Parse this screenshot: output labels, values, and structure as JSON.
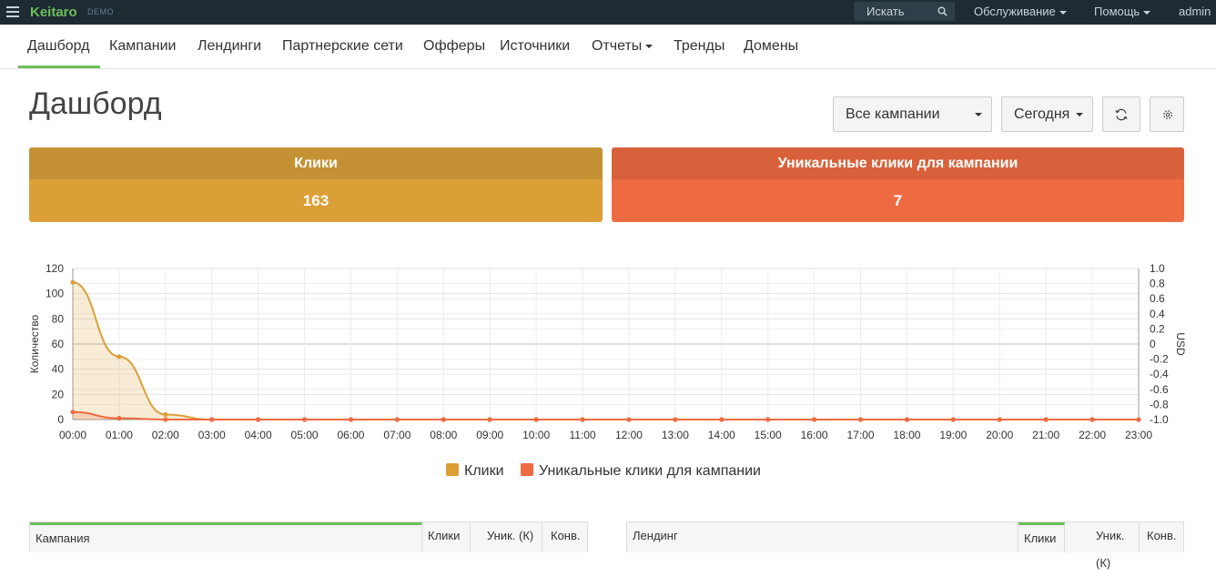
{
  "topbar": {
    "brand": "Keitaro",
    "demo_badge": "DEMO",
    "search_placeholder": "Искать",
    "maintenance": "Обслуживание",
    "help": "Помощь",
    "user": "admin"
  },
  "nav": {
    "items": [
      {
        "label": "Дашборд",
        "active": true
      },
      {
        "label": "Кампании"
      },
      {
        "label": "Лендинги"
      },
      {
        "label": "Партнерские сети"
      },
      {
        "label": "Офферы"
      },
      {
        "label": "Источники"
      },
      {
        "label": "Отчеты",
        "dropdown": true
      },
      {
        "label": "Тренды"
      },
      {
        "label": "Домены"
      }
    ]
  },
  "page": {
    "title": "Дашборд",
    "campaign_filter": "Все кампании",
    "period_filter": "Сегодня",
    "refresh_icon": "refresh-icon",
    "settings_icon": "gear-icon"
  },
  "cards": {
    "clicks": {
      "title": "Клики",
      "value": "163"
    },
    "unique": {
      "title": "Уникальные клики для кампании",
      "value": "7"
    }
  },
  "chart_data": {
    "type": "line",
    "x": [
      "00:00",
      "01:00",
      "02:00",
      "03:00",
      "04:00",
      "05:00",
      "06:00",
      "07:00",
      "08:00",
      "09:00",
      "10:00",
      "11:00",
      "12:00",
      "13:00",
      "14:00",
      "15:00",
      "16:00",
      "17:00",
      "18:00",
      "19:00",
      "20:00",
      "21:00",
      "22:00",
      "23:00"
    ],
    "series": [
      {
        "name": "Клики",
        "color": "#dc9f38",
        "fill": true,
        "values": [
          109,
          50,
          4,
          0,
          0,
          0,
          0,
          0,
          0,
          0,
          0,
          0,
          0,
          0,
          0,
          0,
          0,
          0,
          0,
          0,
          0,
          0,
          0,
          0
        ]
      },
      {
        "name": "Уникальные клики для кампании",
        "color": "#ee6b42",
        "fill": true,
        "values": [
          6,
          1,
          0,
          0,
          0,
          0,
          0,
          0,
          0,
          0,
          0,
          0,
          0,
          0,
          0,
          0,
          0,
          0,
          0,
          0,
          0,
          0,
          0,
          0
        ]
      }
    ],
    "ylabel": "Количество",
    "ylim": [
      0,
      120
    ],
    "yticks": [
      "0",
      "20",
      "40",
      "60",
      "80",
      "100",
      "120"
    ],
    "y2label": "USD",
    "y2lim": [
      -1.0,
      1.0
    ],
    "y2ticks": [
      "-1.0",
      "-0.8",
      "-0.6",
      "-0.4",
      "-0.2",
      "0",
      "0.2",
      "0.4",
      "0.6",
      "0.8",
      "1.0"
    ],
    "grid": true,
    "legend": "bottom"
  },
  "tables": {
    "campaigns": {
      "headers": [
        "Кампания",
        "Клики",
        "Уник. (К)",
        "Конв."
      ]
    },
    "landings": {
      "headers": [
        "Лендинг",
        "Клики",
        "Уник. (К)",
        "Конв."
      ]
    }
  }
}
